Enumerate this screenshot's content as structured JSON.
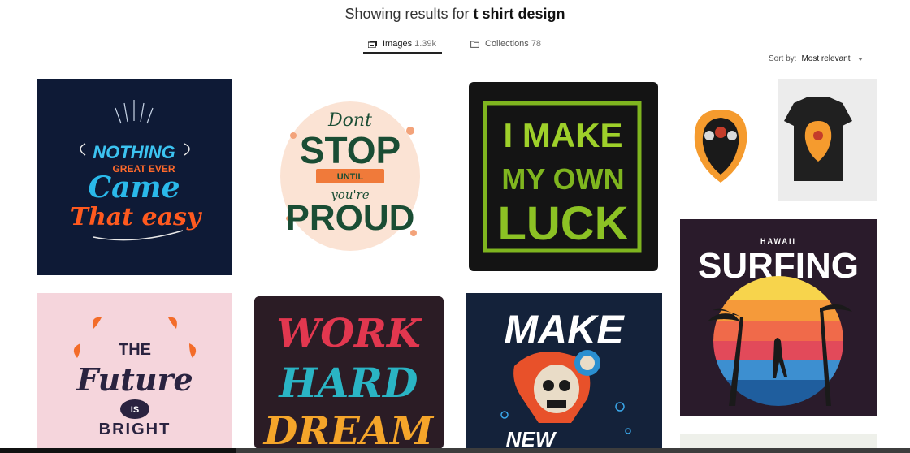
{
  "search": {
    "prefix": "Showing results for ",
    "query": "t shirt design"
  },
  "tabs": [
    {
      "label": "Images",
      "count": "1.39k",
      "icon": "image-stack-icon",
      "active": true
    },
    {
      "label": "Collections",
      "count": "78",
      "icon": "folder-icon",
      "active": false
    }
  ],
  "sort": {
    "label": "Sort by:",
    "value": "Most relevant"
  },
  "results": [
    {
      "kind": "typography",
      "words": [
        "NOTHING",
        "GREAT EVER",
        "Came",
        "That easy"
      ],
      "bg": "#0e1a36"
    },
    {
      "kind": "typography",
      "words": [
        "Dont",
        "STOP",
        "UNTIL",
        "you're",
        "PROUD"
      ],
      "bg": "#ffffff"
    },
    {
      "kind": "typography",
      "words": [
        "I MAKE",
        "MY OWN",
        "LUCK"
      ],
      "bg": "#141414"
    },
    {
      "kind": "mockup",
      "words": [],
      "bg": "#ffffff"
    },
    {
      "kind": "typography",
      "words": [
        "HAWAII",
        "SURFING"
      ],
      "bg": "#2a1b2b"
    },
    {
      "kind": "typography",
      "words": [
        "THE",
        "Future",
        "IS",
        "BRIGHT"
      ],
      "bg": "#f5d5dc"
    },
    {
      "kind": "typography",
      "words": [
        "WORK",
        "HARD",
        "DREAM"
      ],
      "bg": "#2b1c25"
    },
    {
      "kind": "illustration",
      "words": [
        "MAKE",
        "NEW"
      ],
      "bg": "#14223a"
    }
  ],
  "colors": {
    "accent": "#222222",
    "muted": "#777777"
  }
}
